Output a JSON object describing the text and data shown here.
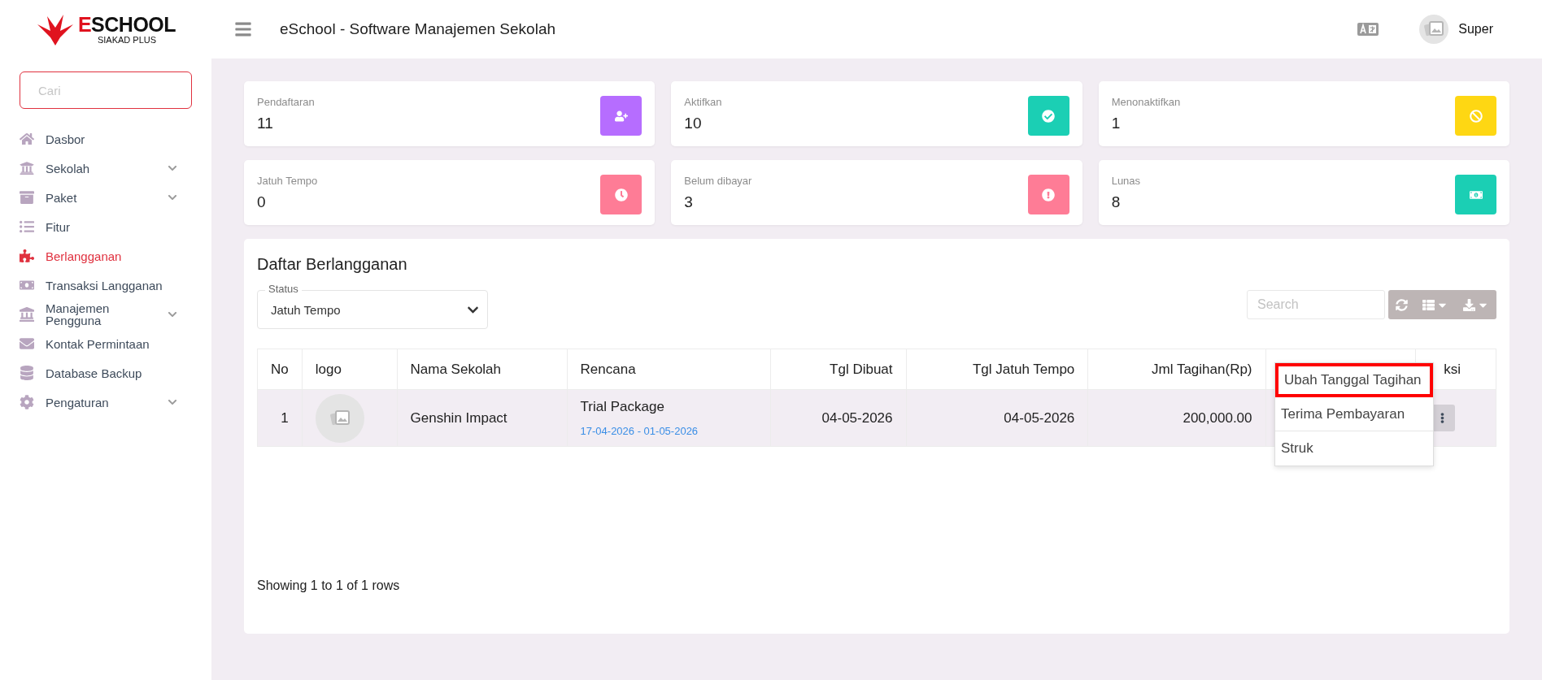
{
  "logo": {
    "accent": "E",
    "name": "SCHOOL",
    "subtitle": "SIAKAD PLUS"
  },
  "header": {
    "title": "eSchool - Software Manajemen Sekolah",
    "user": "Super"
  },
  "sidebar": {
    "search": {
      "placeholder": "Cari"
    },
    "items": [
      {
        "label": "Dasbor",
        "expandable": false,
        "selected": false
      },
      {
        "label": "Sekolah",
        "expandable": true,
        "selected": false
      },
      {
        "label": "Paket",
        "expandable": true,
        "selected": false
      },
      {
        "label": "Fitur",
        "expandable": false,
        "selected": false
      },
      {
        "label": "Berlangganan",
        "expandable": false,
        "selected": true
      },
      {
        "label": "Transaksi Langganan",
        "expandable": false,
        "selected": false
      },
      {
        "label": "Manajemen Pengguna",
        "expandable": true,
        "selected": false
      },
      {
        "label": "Kontak Permintaan",
        "expandable": false,
        "selected": false
      },
      {
        "label": "Database Backup",
        "expandable": false,
        "selected": false
      },
      {
        "label": "Pengaturan",
        "expandable": true,
        "selected": false
      }
    ]
  },
  "stats": [
    {
      "label": "Pendaftaran",
      "value": "11",
      "color": "#b66dff"
    },
    {
      "label": "Aktifkan",
      "value": "10",
      "color": "#1bcfb4"
    },
    {
      "label": "Menonaktifkan",
      "value": "1",
      "color": "#fed713"
    },
    {
      "label": "Jatuh Tempo",
      "value": "0",
      "color": "#fe7c96"
    },
    {
      "label": "Belum dibayar",
      "value": "3",
      "color": "#fe7c96"
    },
    {
      "label": "Lunas",
      "value": "8",
      "color": "#1bcfb4"
    }
  ],
  "subscriptions": {
    "title": "Daftar Berlangganan",
    "status_filter": {
      "label": "Status",
      "value": "Jatuh Tempo"
    },
    "search": {
      "placeholder": "Search"
    },
    "columns": [
      {
        "label": "No"
      },
      {
        "label": "logo"
      },
      {
        "label": "Nama Sekolah"
      },
      {
        "label": "Rencana"
      },
      {
        "label": "Tgl Dibuat"
      },
      {
        "label": "Tgl Jatuh Tempo"
      },
      {
        "label": "Jml Tagihan(Rp)"
      },
      {},
      {
        "label": "ksi"
      }
    ],
    "rows": [
      {
        "no": "1",
        "school": "Genshin Impact",
        "plan": "Trial Package",
        "period": "17-04-2026 - 01-05-2026",
        "created": "04-05-2026",
        "due": "04-05-2026",
        "amount": "200,000.00"
      }
    ],
    "row_menu": {
      "items": [
        {
          "label": "Ubah Tanggal Tagihan",
          "highlighted": true
        },
        {
          "label": "Terima Pembayaran",
          "highlighted": false
        },
        {
          "label": "Struk",
          "highlighted": false
        }
      ]
    },
    "footer": "Showing 1 to 1 of 1 rows"
  }
}
